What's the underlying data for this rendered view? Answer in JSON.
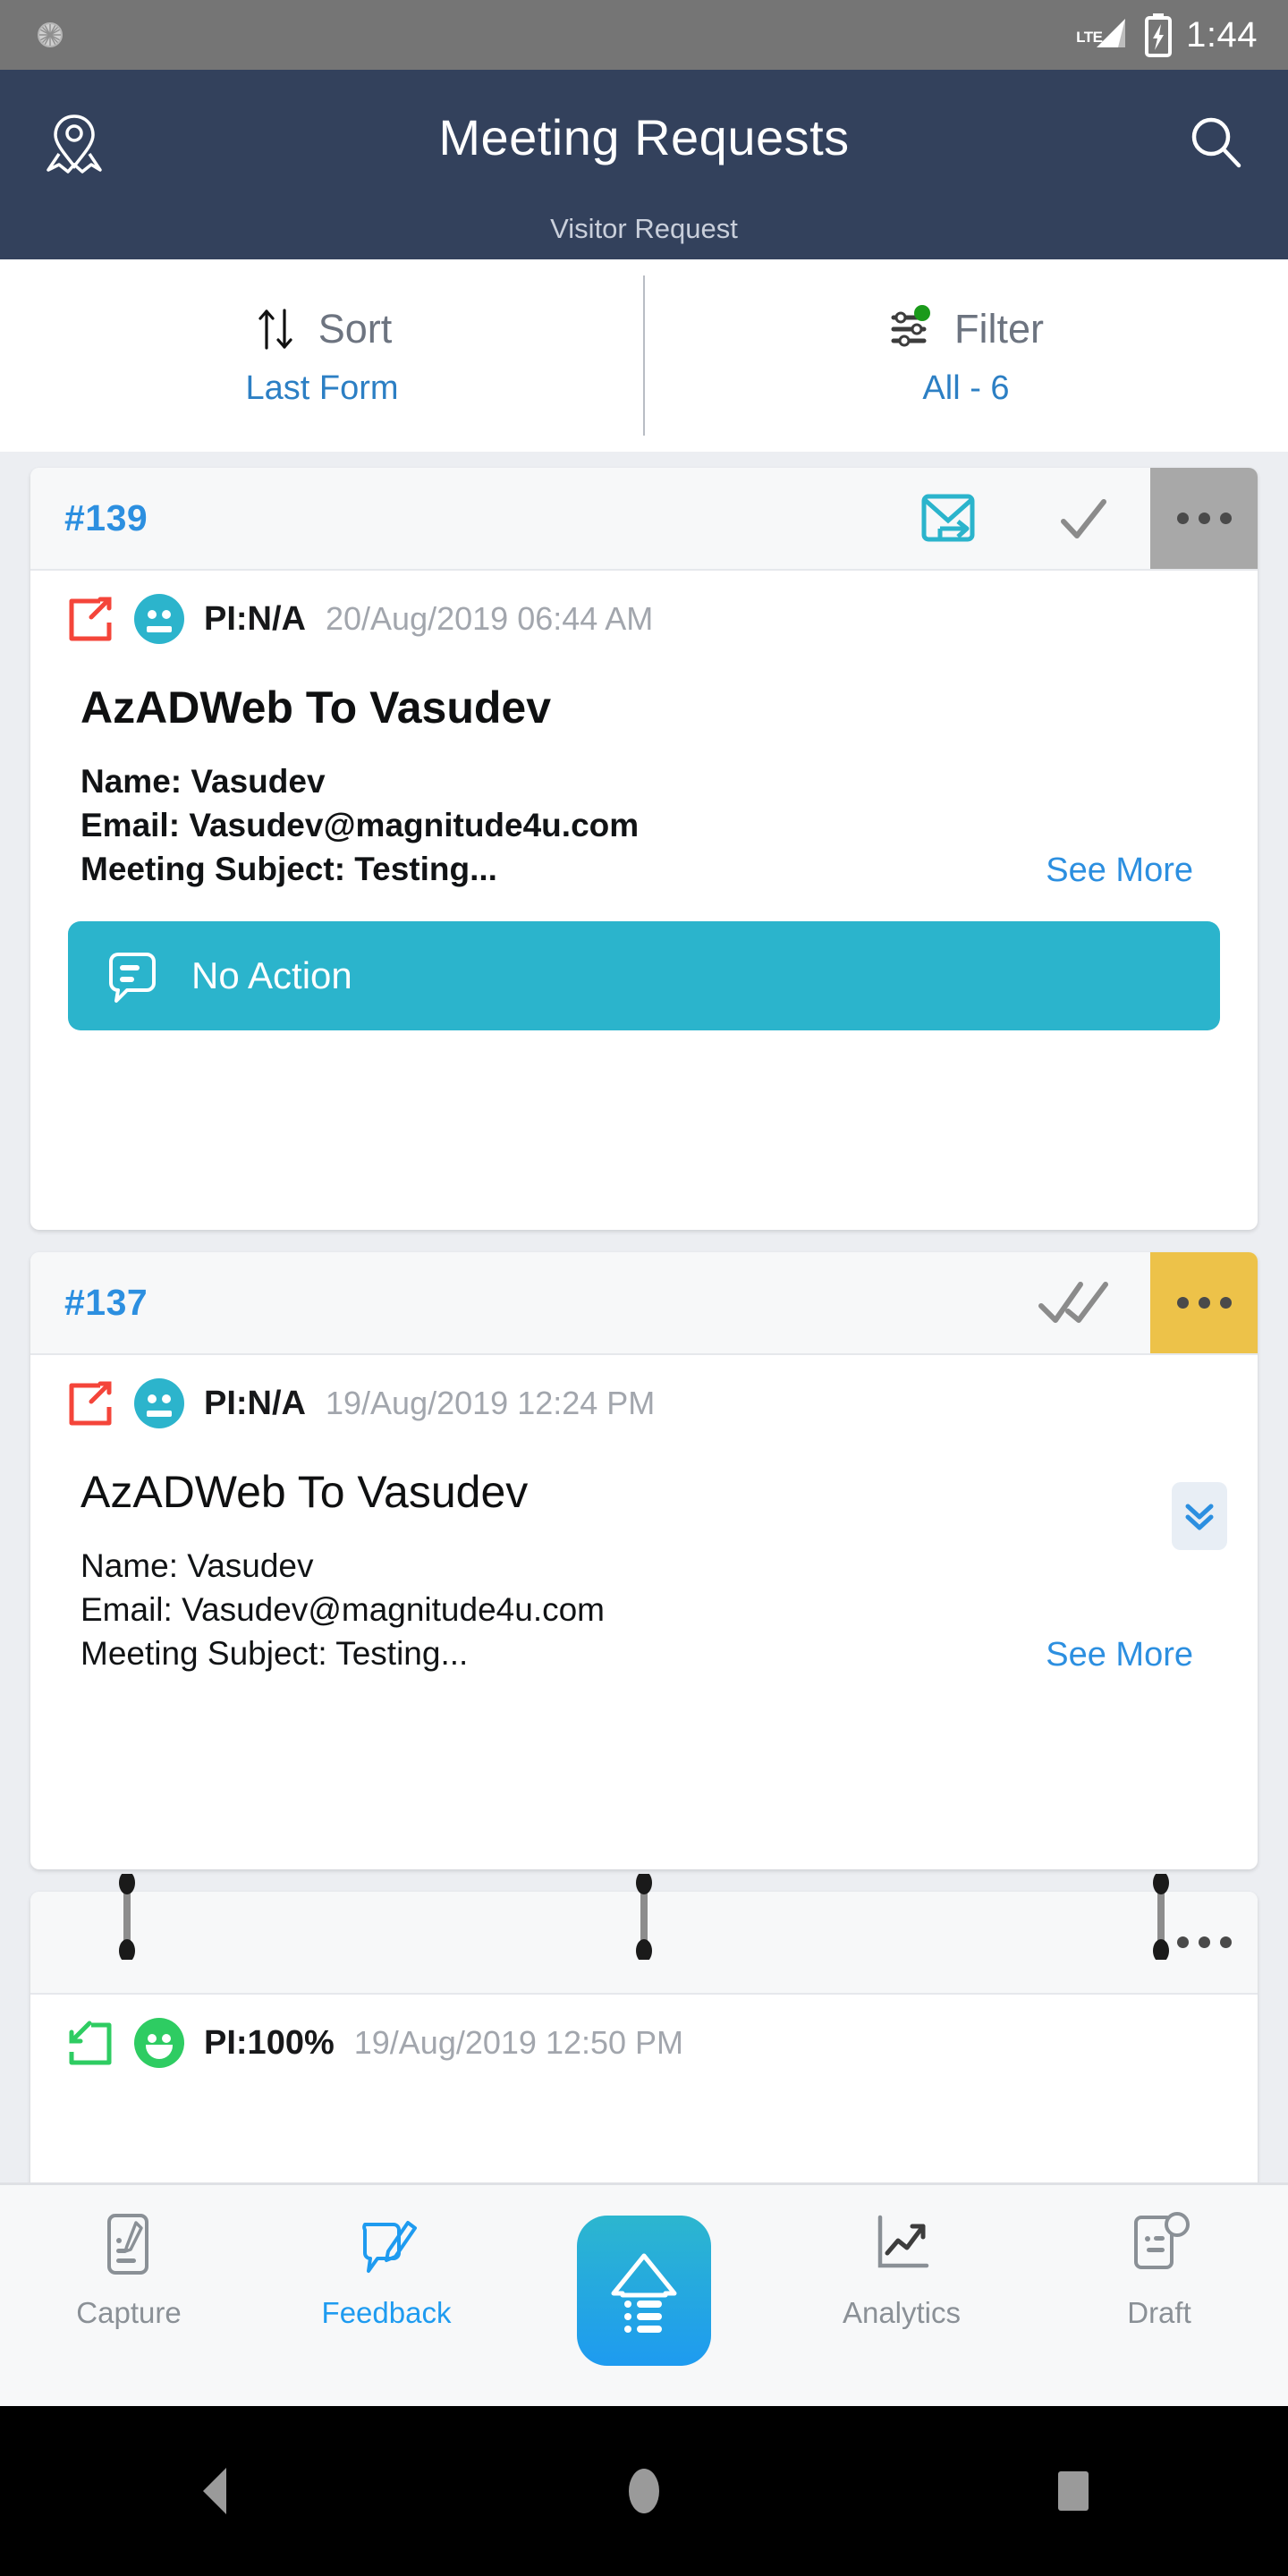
{
  "status_bar": {
    "clock": "1:44",
    "network": "LTE",
    "icons": [
      "brightness-sun-icon",
      "signal-bars-icon",
      "battery-charging-icon"
    ]
  },
  "app_bar": {
    "title": "Meeting Requests",
    "subtitle": "Visitor Request",
    "left_icon": "map-pin-badge-icon",
    "right_icon": "search-icon"
  },
  "toolbar": {
    "sort": {
      "label": "Sort",
      "value": "Last Form",
      "icon": "sort-arrows-icon"
    },
    "filter": {
      "label": "Filter",
      "value": "All - 6",
      "icon": "filter-sliders-icon",
      "badge_color": "#1a9a1a"
    }
  },
  "cards": [
    {
      "id": "#139",
      "status_icons": [
        "mail-forward-icon",
        "single-check-icon"
      ],
      "more_label": "more-options",
      "more_bg": "#a8a8a8",
      "direction_icon": "outbound-arrow-icon",
      "direction_color": "#f4453a",
      "face": "neutral-face-icon",
      "face_color": "#2cb4cc",
      "pi": "PI:N/A",
      "date": "20/Aug/2019 06:44 AM",
      "title": "AzADWeb To Vasudev",
      "bold": true,
      "details": [
        "Name: Vasudev",
        "Email: Vasudev@magnitude4u.com",
        "Meeting Subject: Testing..."
      ],
      "see_more": "See More",
      "action": {
        "label": "No Action",
        "icon": "comment-lines-icon",
        "color": "#2bb4cc"
      }
    },
    {
      "id": "#137",
      "status_icons": [
        "double-check-icon"
      ],
      "more_label": "more-options",
      "more_bg": "#edc249",
      "direction_icon": "outbound-arrow-icon",
      "direction_color": "#f4453a",
      "face": "neutral-face-icon",
      "face_color": "#2cb4cc",
      "pi": "PI:N/A",
      "date": "19/Aug/2019 12:24 PM",
      "title": "AzADWeb To Vasudev",
      "bold": false,
      "details": [
        "Name: Vasudev",
        "Email: Vasudev@magnitude4u.com",
        "Meeting Subject: Testing..."
      ],
      "see_more": "See More",
      "expand_icon": "chevron-double-down-icon"
    },
    {
      "id": "",
      "status_icons": [],
      "more_label": "more-options",
      "more_bg": "transparent",
      "direction_icon": "inbound-arrow-icon",
      "direction_color": "#2ecc62",
      "face": "happy-face-icon",
      "face_color": "#2ecc62",
      "pi": "PI:100%",
      "date": "19/Aug/2019 12:50 PM",
      "title": "",
      "bold": false,
      "details": [],
      "see_more": ""
    }
  ],
  "drag_handles": {
    "count": 3,
    "name": "drag-handle"
  },
  "bottom_nav": {
    "items": [
      {
        "label": "Capture",
        "icon": "capture-note-icon",
        "active": false
      },
      {
        "label": "Feedback",
        "icon": "feedback-pencil-icon",
        "active": true
      },
      {
        "label": "",
        "icon": "home-list-icon",
        "active": false,
        "center": true
      },
      {
        "label": "Analytics",
        "icon": "analytics-chart-icon",
        "active": false
      },
      {
        "label": "Draft",
        "icon": "draft-document-icon",
        "active": false
      }
    ],
    "active_color": "#1e9bf0",
    "inactive_color": "#8a9096"
  },
  "android_nav": {
    "back": "back-triangle-icon",
    "home": "home-circle-icon",
    "recents": "recents-square-icon"
  }
}
